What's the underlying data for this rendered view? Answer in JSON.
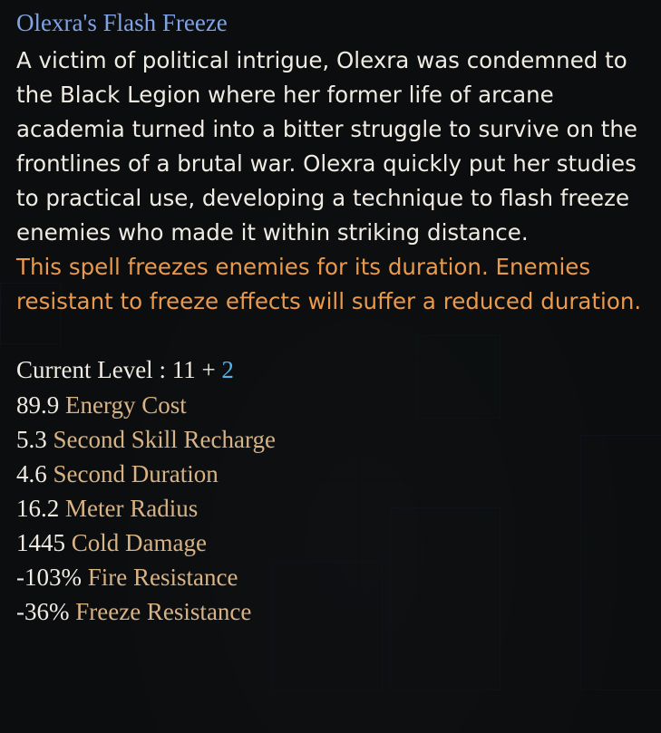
{
  "tooltip": {
    "title": "Olexra's Flash Freeze",
    "lore": "A victim of political intrigue, Olexra was condemned to the Black Legion where her former life of arcane academia turned into a bitter struggle to survive on the frontlines of a brutal war. Olexra quickly put her studies to practical use, developing a technique to flash freeze enemies who made it within striking distance.",
    "effect": "This spell freezes enemies for its duration. Enemies resistant to freeze effects will suffer a reduced duration.",
    "level_label": "Current Level : 11 + ",
    "level_bonus": "2",
    "stats": [
      {
        "value": "89.9",
        "label": " Energy Cost"
      },
      {
        "value": "5.3",
        "label": " Second Skill Recharge"
      },
      {
        "value": "4.6",
        "label": " Second Duration"
      },
      {
        "value": "16.2",
        "label": " Meter Radius"
      },
      {
        "value": "1445",
        "label": " Cold Damage"
      },
      {
        "value": "-103%",
        "label": " Fire Resistance"
      },
      {
        "value": "-36%",
        "label": " Freeze Resistance"
      }
    ]
  },
  "colors": {
    "title": "#7fa3e6",
    "lore": "#f0ece4",
    "effect": "#e99a4c",
    "bonus": "#52b3e6",
    "stat_label": "#d8b385"
  }
}
